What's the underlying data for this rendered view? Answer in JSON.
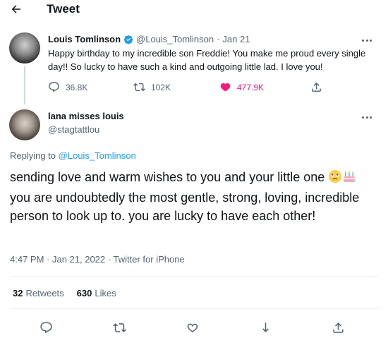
{
  "header": {
    "title": "Tweet"
  },
  "tweet1": {
    "name": "Louis Tomlinson",
    "handle": "@Louis_Tomlinson",
    "date": "Jan 21",
    "separator": "·",
    "text": "Happy birthday to my incredible son Freddie! You make me proud every single day!! So lucky to have such a kind and outgoing little lad. I love you!",
    "replies": "36.8K",
    "retweets": "102K",
    "likes": "477.9K"
  },
  "tweet2": {
    "name": "lana misses louis",
    "handle": "@stagtattlou",
    "replying_prefix": "Replying to",
    "replying_to": "@Louis_Tomlinson",
    "text_part1": "sending love and warm wishes to you and your little one",
    "text_part2": "you are undoubtedly the most gentle, strong, loving, incredible person to look up to. you are lucky to have each other!",
    "time": "4:47 PM · Jan 21, 2022",
    "meta_separator": "·",
    "source": "Twitter for iPhone",
    "retweets_count": "32",
    "retweets_label": "Retweets",
    "likes_count": "630",
    "likes_label": "Likes"
  },
  "icons": {
    "back": "arrow-left-icon",
    "verified": "verified-badge-icon",
    "more": "more-dots-icon",
    "reply": "reply-icon",
    "retweet": "retweet-icon",
    "like": "heart-icon",
    "share": "share-icon",
    "bookmark": "bookmark-icon"
  },
  "colors": {
    "accent": "#1d9bf0",
    "like_active": "#f91880",
    "text": "#0f1419",
    "muted": "#536471"
  }
}
